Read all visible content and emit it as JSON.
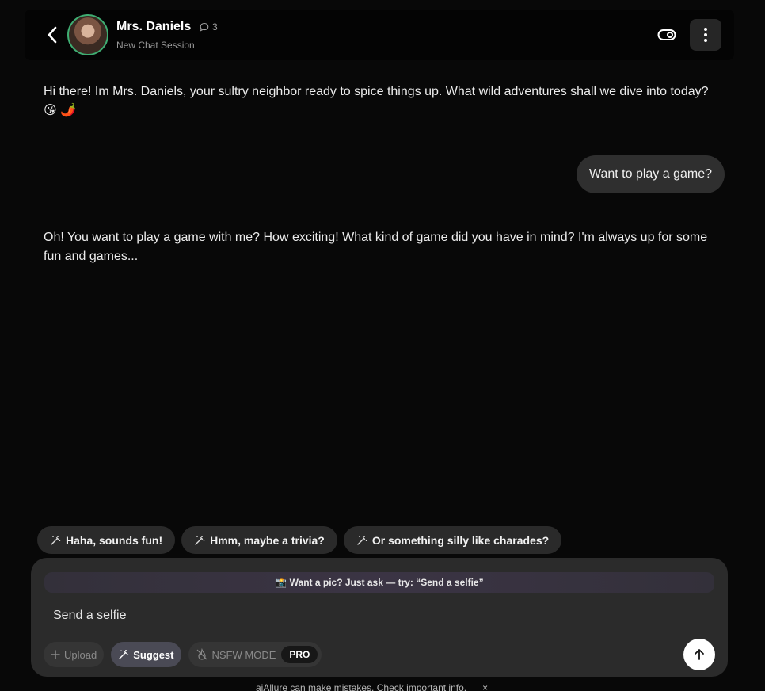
{
  "header": {
    "name": "Mrs. Daniels",
    "message_count": "3",
    "subtitle": "New Chat Session"
  },
  "messages": [
    {
      "role": "assistant",
      "text": "Hi there! Im Mrs. Daniels, your sultry neighbor ready to spice things up. What wild adventures shall we dive into today? 😘 🌶️"
    },
    {
      "role": "user",
      "text": "Want to play a game?"
    },
    {
      "role": "assistant",
      "text": "Oh! You want to play a game with me? How exciting! What kind of game did you have in mind? I'm always up for some fun and games..."
    }
  ],
  "suggestions": [
    "Haha, sounds fun!",
    "Hmm, maybe a trivia?",
    "Or something silly like charades?"
  ],
  "composer": {
    "hint": "📸 Want a pic? Just ask — try: “Send a selfie”",
    "input_value": "Send a selfie",
    "upload_label": "Upload",
    "suggest_label": "Suggest",
    "nsfw_label": "NSFW MODE",
    "pro_label": "PRO"
  },
  "footer": {
    "note": "aiAllure can make mistakes. Check important info.",
    "close": "×"
  },
  "colors": {
    "background": "#080808",
    "avatar_ring": "#3fae73",
    "user_bubble": "#2f2f2f",
    "chip": "#2a2a2a",
    "composer": "#2b2b2b"
  }
}
